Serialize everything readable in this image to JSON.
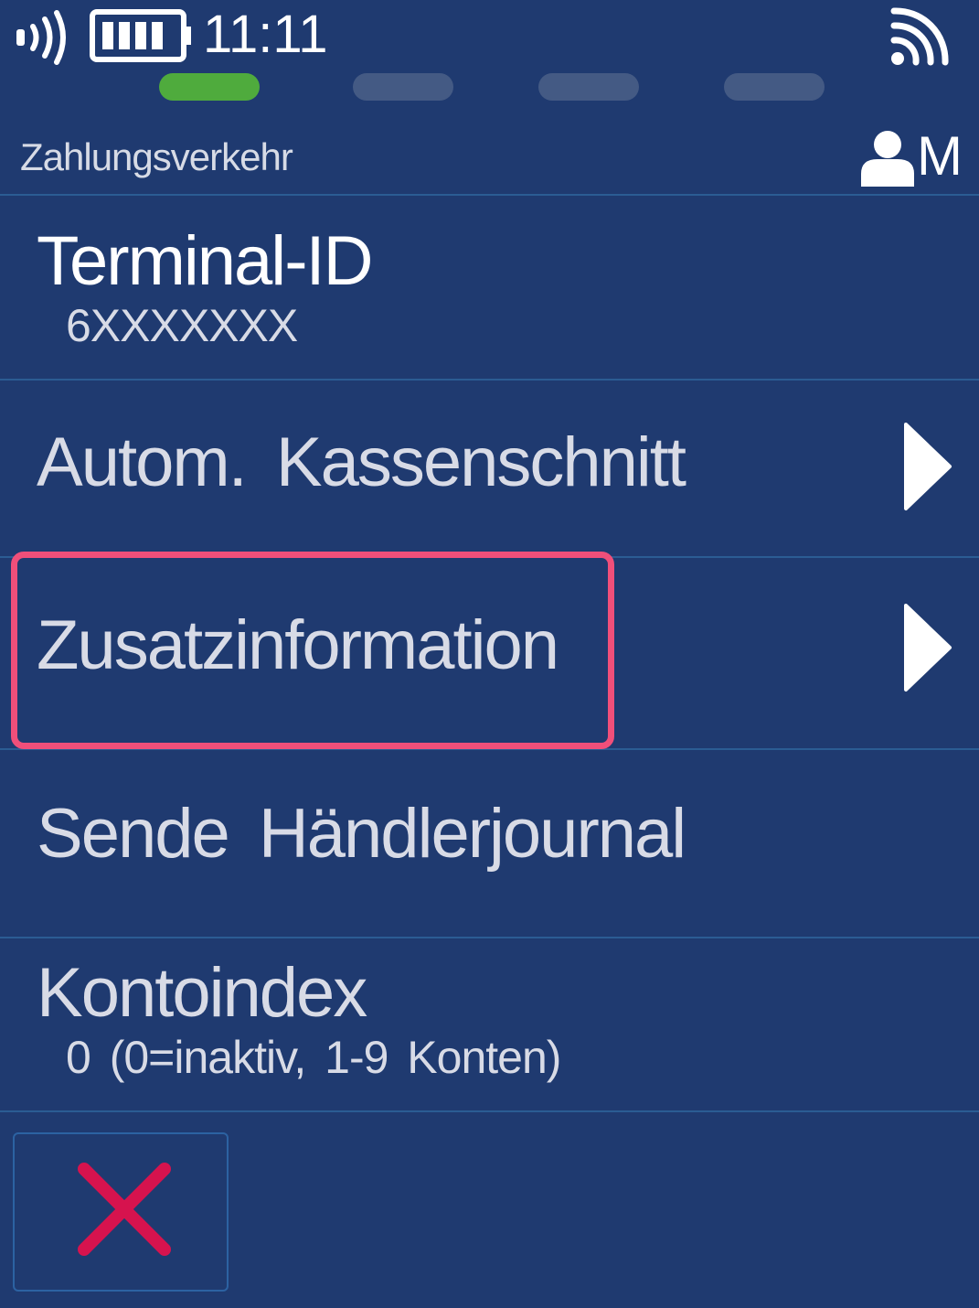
{
  "status_bar": {
    "time": "11:11",
    "nfc_icon": "nfc-contactless-icon",
    "battery_icon": "battery-icon",
    "signal_icon": "wifi-signal-icon"
  },
  "progress": {
    "total_steps": 4,
    "active_step": 1,
    "active_color": "#4fab3d",
    "inactive_color": "#445a84"
  },
  "header": {
    "title": "Zahlungsverkehr",
    "user_icon": "user-icon",
    "user_level": "M"
  },
  "menu": {
    "items": [
      {
        "label": "Terminal-ID",
        "value": "6XXXXXXX"
      },
      {
        "label": "Autom. Kassenschnitt"
      },
      {
        "label": "Zusatzinformation"
      },
      {
        "label": "Sende Händlerjournal"
      },
      {
        "label": "Kontoindex",
        "value": "0 (0=inaktiv, 1-9 Konten)"
      }
    ]
  },
  "footer": {
    "cancel_icon": "close-icon"
  },
  "colors": {
    "background": "#1f3a70",
    "divider": "#2b5c93",
    "highlight": "#f04f7a",
    "cancel": "#d6134e"
  }
}
